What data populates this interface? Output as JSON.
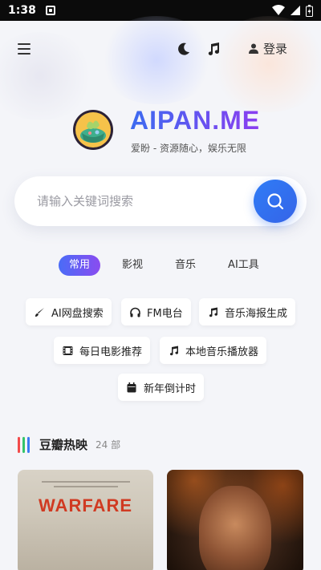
{
  "statusbar": {
    "time": "1:38"
  },
  "header": {
    "login_label": "登录"
  },
  "brand": {
    "title": "AIPAN.ME",
    "subtitle": "爱盼 - 资源随心，娱乐无限"
  },
  "search": {
    "placeholder": "请输入关键词搜索"
  },
  "tabs": [
    {
      "label": "常用",
      "active": true
    },
    {
      "label": "影视",
      "active": false
    },
    {
      "label": "音乐",
      "active": false
    },
    {
      "label": "AI工具",
      "active": false
    }
  ],
  "tools": [
    {
      "label": "AI网盘搜索",
      "icon": "brush-icon",
      "color": "#2a2a2a"
    },
    {
      "label": "FM电台",
      "icon": "headphones-icon",
      "color": "#2a2a2a"
    },
    {
      "label": "音乐海报生成",
      "icon": "music-note-icon",
      "color": "#2a2a2a"
    },
    {
      "label": "每日电影推荐",
      "icon": "film-icon",
      "color": "#2a2a2a"
    },
    {
      "label": "本地音乐播放器",
      "icon": "music-note-icon",
      "color": "#2a2a2a"
    },
    {
      "label": "新年倒计时",
      "icon": "calendar-icon",
      "color": "#2a2a2a"
    }
  ],
  "section": {
    "title": "豆瓣热映",
    "count": "24 部",
    "bar_colors": [
      "#f24b4b",
      "#35c46a",
      "#3a7cf2"
    ]
  },
  "movies": [
    {
      "poster_text": "WARFARE"
    },
    {
      "poster_text": ""
    }
  ],
  "colors": {
    "accent": "#3b6bf0",
    "accent2": "#8b3ef0"
  }
}
